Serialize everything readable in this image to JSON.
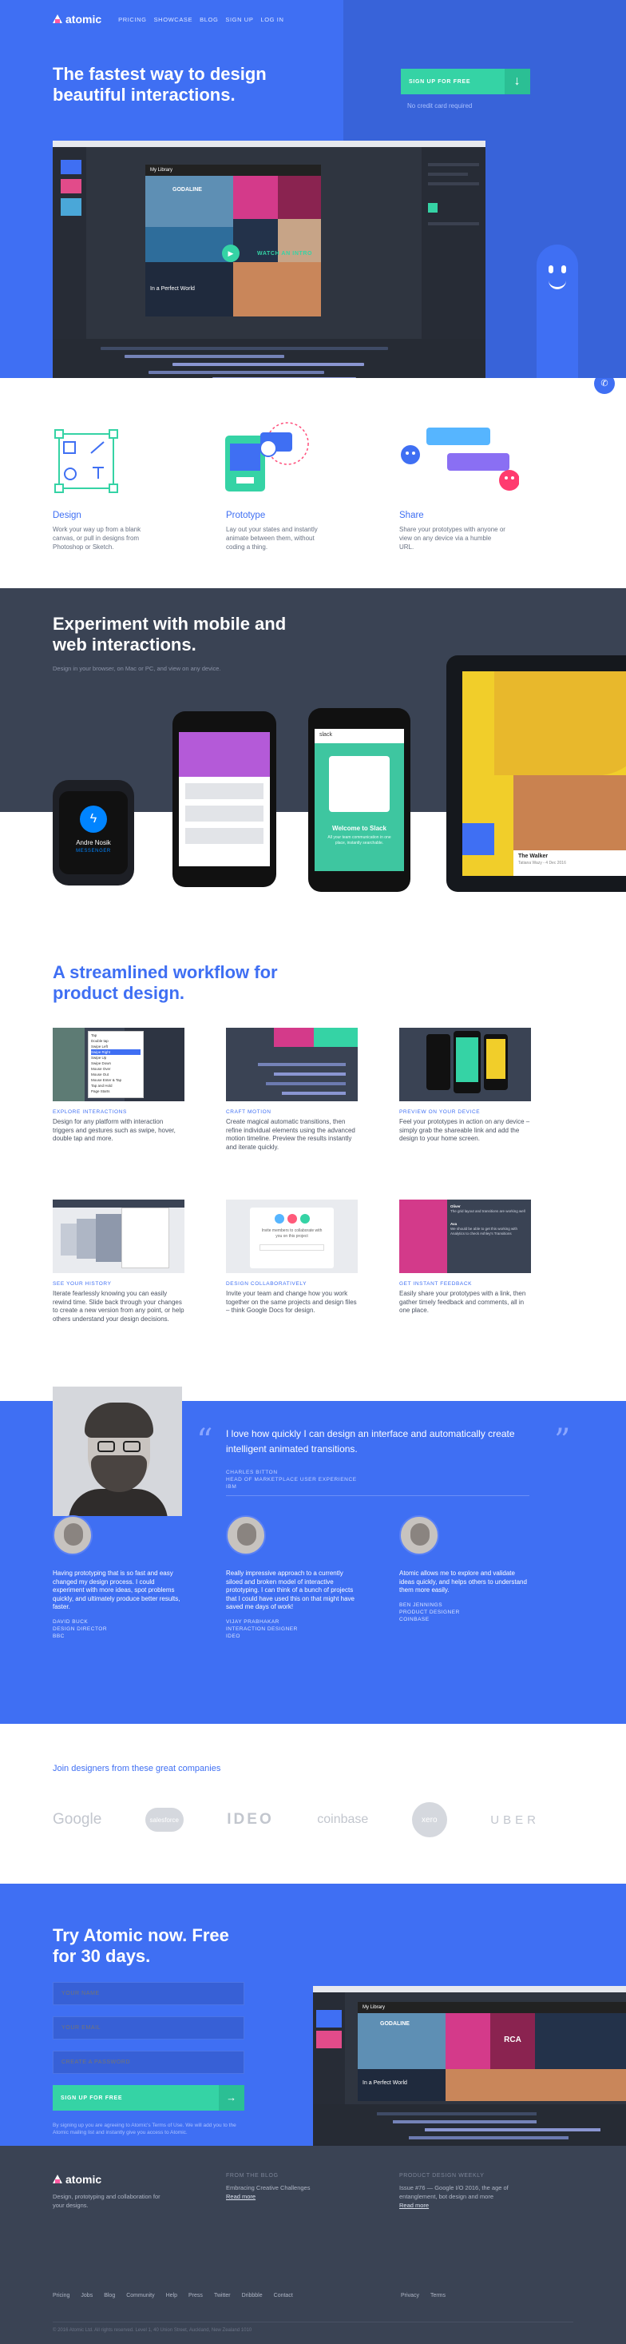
{
  "nav": {
    "brand": "atomic",
    "items": [
      "PRICING",
      "SHOWCASE",
      "BLOG",
      "SIGN UP",
      "LOG IN"
    ]
  },
  "hero": {
    "title": "The fastest way to design beautiful interactions.",
    "cta": "SIGN UP FOR FREE",
    "cta_arrow": "↓",
    "note": "No credit card required",
    "canvas_title": "My Library",
    "watch_intro": "WATCH AN INTRO",
    "tile_album": "In a Perfect World",
    "tile_title": "GODALINE"
  },
  "features": [
    {
      "title": "Design",
      "desc": "Work your way up from a blank canvas, or pull in designs from Photoshop or Sketch."
    },
    {
      "title": "Prototype",
      "desc": "Lay out your states and instantly animate between them, without coding a thing."
    },
    {
      "title": "Share",
      "desc": "Share your prototypes with anyone or view on any device via a humble URL."
    }
  ],
  "devices": {
    "title": "Experiment with mobile and web interactions.",
    "subtitle": "Design in your browser, on Mac or PC, and view on any device.",
    "watch_name": "Andre Nosik",
    "watch_app": "MESSENGER",
    "slack_brand": "slack",
    "slack_title": "Welcome to Slack",
    "slack_sub": "All your team communication in one place, instantly searchable.",
    "tablet_title": "The Walker",
    "tablet_sub": "Tatiana Wazy - 4 Dec 2016"
  },
  "workflow": {
    "title": "A streamlined workflow for product design.",
    "items": [
      {
        "label": "EXPLORE INTERACTIONS",
        "desc": "Design for any platform with interaction triggers and gestures such as swipe, hover, double tap and more."
      },
      {
        "label": "CRAFT MOTION",
        "desc": "Create magical automatic transitions, then refine individual elements using the advanced motion timeline. Preview the results instantly and iterate quickly."
      },
      {
        "label": "PREVIEW ON YOUR DEVICE",
        "desc": "Feel your prototypes in action on any device – simply grab the shareable link and add the design to your home screen."
      },
      {
        "label": "SEE YOUR HISTORY",
        "desc": "Iterate fearlessly knowing you can easily rewind time. Slide back through your changes to create a new version from any point, or help others understand your design decisions."
      },
      {
        "label": "DESIGN COLLABORATIVELY",
        "desc": "Invite your team and change how you work together on the same projects and design files – think Google Docs for design."
      },
      {
        "label": "GET INSTANT FEEDBACK",
        "desc": "Easily share your prototypes with a link, then gather timely feedback and comments, all in one place."
      }
    ],
    "menu_items": [
      "Tap",
      "Double tap",
      "Swipe Left",
      "Swipe Right",
      "Swipe Up",
      "Swipe Down",
      "Mouse Over",
      "Mouse Out",
      "Mouse Enter & Tap",
      "Tap and Hold",
      "Page Starts"
    ],
    "invite_text": "Invite members to collaborate with you on this project",
    "comments": [
      {
        "name": "Oliver",
        "text": "The grid layout and transitions are working well"
      },
      {
        "name": "Ava",
        "text": "We should be able to get this working with Analytics to check Ashley's Transitions"
      }
    ]
  },
  "testimonials": {
    "quote": "I love how quickly I can design an interface and automatically create intelligent animated transitions.",
    "author": "CHARLES BITTON",
    "role": "HEAD OF MARKETPLACE USER EXPERIENCE",
    "company": "IBM",
    "open_mark": "“",
    "close_mark": "”",
    "cards": [
      {
        "text": "Having prototyping that is so fast and easy changed my design process. I could experiment with more ideas, spot problems quickly, and ultimately produce better results, faster.",
        "name": "DAVID BUCK",
        "role": "DESIGN DIRECTOR",
        "company": "BBC"
      },
      {
        "text": "Really impressive approach to a currently siloed and broken model of interactive prototyping. I can think of a bunch of projects that I could have used this on that might have saved me days of work!",
        "name": "VIJAY PRABHAKAR",
        "role": "INTERACTION DESIGNER",
        "company": "IDEO"
      },
      {
        "text": "Atomic allows me to explore and validate ideas quickly, and helps others to understand them more easily.",
        "name": "BEN JENNINGS",
        "role": "PRODUCT DESIGNER",
        "company": "COINBASE"
      }
    ]
  },
  "clients": {
    "title": "Join designers from these great companies",
    "logos": [
      "Google",
      "salesforce",
      "IDEO",
      "coinbase",
      "xero",
      "UBER"
    ]
  },
  "try": {
    "title": "Try Atomic now. Free for 30 days.",
    "fields": [
      "YOUR NAME",
      "YOUR EMAIL",
      "CREATE A PASSWORD"
    ],
    "button": "SIGN UP FOR FREE",
    "button_arrow": "→",
    "legal": "By signing up you are agreeing to Atomic's Terms of Use. We will add you to the Atomic mailing list and instantly give you access to Atomic.",
    "canvas_title": "My Library",
    "tile_album": "In a Perfect World",
    "tile_title": "GODALINE",
    "tile_label": "RCA"
  },
  "footer": {
    "brand": "atomic",
    "tagline": "Design, prototyping and collaboration for your designs.",
    "blog_head": "FROM THE BLOG",
    "blog_text": "Embracing Creative Challenges",
    "blog_link": "Read more",
    "weekly_head": "PRODUCT DESIGN WEEKLY",
    "weekly_text": "Issue #76 — Google I/O 2016, the age of entanglement, bot design and more",
    "weekly_link": "Read more",
    "links": [
      "Pricing",
      "Jobs",
      "Blog",
      "Community",
      "Help",
      "Press",
      "Twitter",
      "Dribbble",
      "Contact"
    ],
    "links2": [
      "Privacy",
      "Terms"
    ],
    "copyright": "© 2016 Atomic Ltd. All rights reserved. Level 1, 40 Union Street, Auckland, New Zealand 1010"
  },
  "colors": {
    "brand": "#3f6ff3",
    "accent": "#35d3a5",
    "dark": "#3a4354"
  }
}
